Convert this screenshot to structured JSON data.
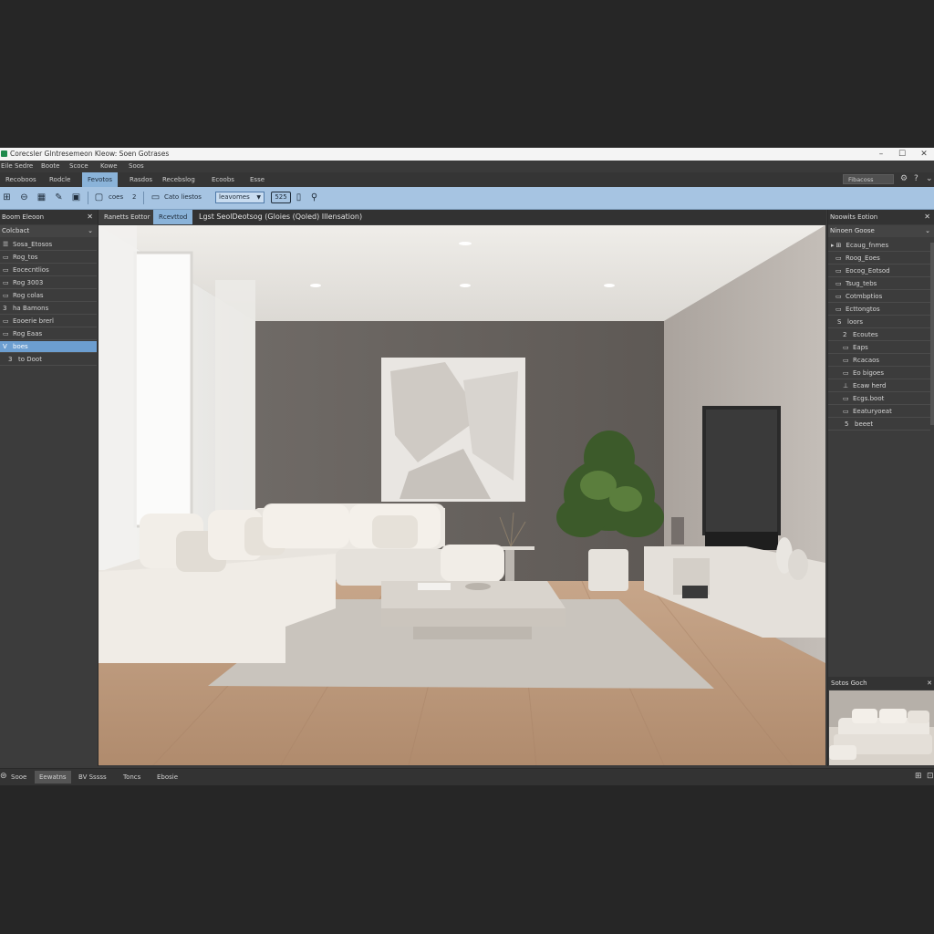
{
  "window": {
    "title": "Corecsler Glntresemeon Kleow: Soen Gotrases",
    "controls": {
      "minimize": "–",
      "maximize": "☐",
      "close": "✕"
    }
  },
  "menu": [
    "Eile",
    "Sedre",
    "Boote",
    "Scoce",
    "Kowe",
    "Soos"
  ],
  "ribbon": {
    "tabs": [
      "Recoboos",
      "Rodcle",
      "Fevotos",
      "Rasdos",
      "Recebslog",
      "Ecoobs",
      "Esse"
    ],
    "search": "Fibacoss"
  },
  "toolbar": {
    "label1": "coes",
    "label2": "2",
    "label3": "Cato liestos",
    "select": "leavomes",
    "badge": "525"
  },
  "left_panel": {
    "title": "Boom Eleoon",
    "dropdown": "Colcbact",
    "items": [
      {
        "icon": "☰",
        "label": "Sosa_Etosos"
      },
      {
        "icon": "▭",
        "label": "Rog_tos"
      },
      {
        "icon": "▭",
        "label": "Eocecntlios"
      },
      {
        "icon": "▭",
        "label": "Rog 3003"
      },
      {
        "icon": "▭",
        "label": "Rog colas"
      },
      {
        "icon": "3",
        "label": "ha Bamons"
      },
      {
        "icon": "▭",
        "label": "Eooerie brerl"
      },
      {
        "icon": "▭",
        "label": "Rog Eaas"
      },
      {
        "icon": "V",
        "label": "boes"
      },
      {
        "icon": "3",
        "label": "to Doot"
      }
    ]
  },
  "viewport": {
    "tabs": [
      "Ranetts Eottor",
      "Rcevttod"
    ],
    "title": "Lgst SeolDeotsog (Gloies (Qoled) Illensation)"
  },
  "right_panel": {
    "title": "Noowits Eotion",
    "subtitle": "Ninoen Goose",
    "items": [
      {
        "icon": "⊞",
        "label": "Ecaug_fnmes"
      },
      {
        "icon": "▭",
        "label": "Roog_Eoes"
      },
      {
        "icon": "▭",
        "label": "Eocog_Eotsod"
      },
      {
        "icon": "▭",
        "label": "Tsug_tebs"
      },
      {
        "icon": "▭",
        "label": "Cotmbptios"
      },
      {
        "icon": "▭",
        "label": "Ecttongtos"
      },
      {
        "icon": "S",
        "label": "loors"
      },
      {
        "icon": "2",
        "label": "Ecoutes"
      },
      {
        "icon": "▭",
        "label": "Eaps"
      },
      {
        "icon": "▭",
        "label": "Rcacaos"
      },
      {
        "icon": "▭",
        "label": "Eo bigoes"
      },
      {
        "icon": "⊥",
        "label": "Ecaw herd"
      },
      {
        "icon": "▭",
        "label": "Ecgs.boot"
      },
      {
        "icon": "▭",
        "label": "Eeaturyoeat"
      },
      {
        "icon": "5",
        "label": "beeet"
      }
    ],
    "preview_title": "Sotos Goch"
  },
  "status_tabs": [
    "Sooe",
    "Eewatns",
    "BV Sssss",
    "Toncs",
    "Ebosie"
  ],
  "colors": {
    "accent": "#8ab3d9",
    "toolbar": "#a6c4e2",
    "panel_bg": "#3c3c3c",
    "backdrop": "#262626"
  }
}
